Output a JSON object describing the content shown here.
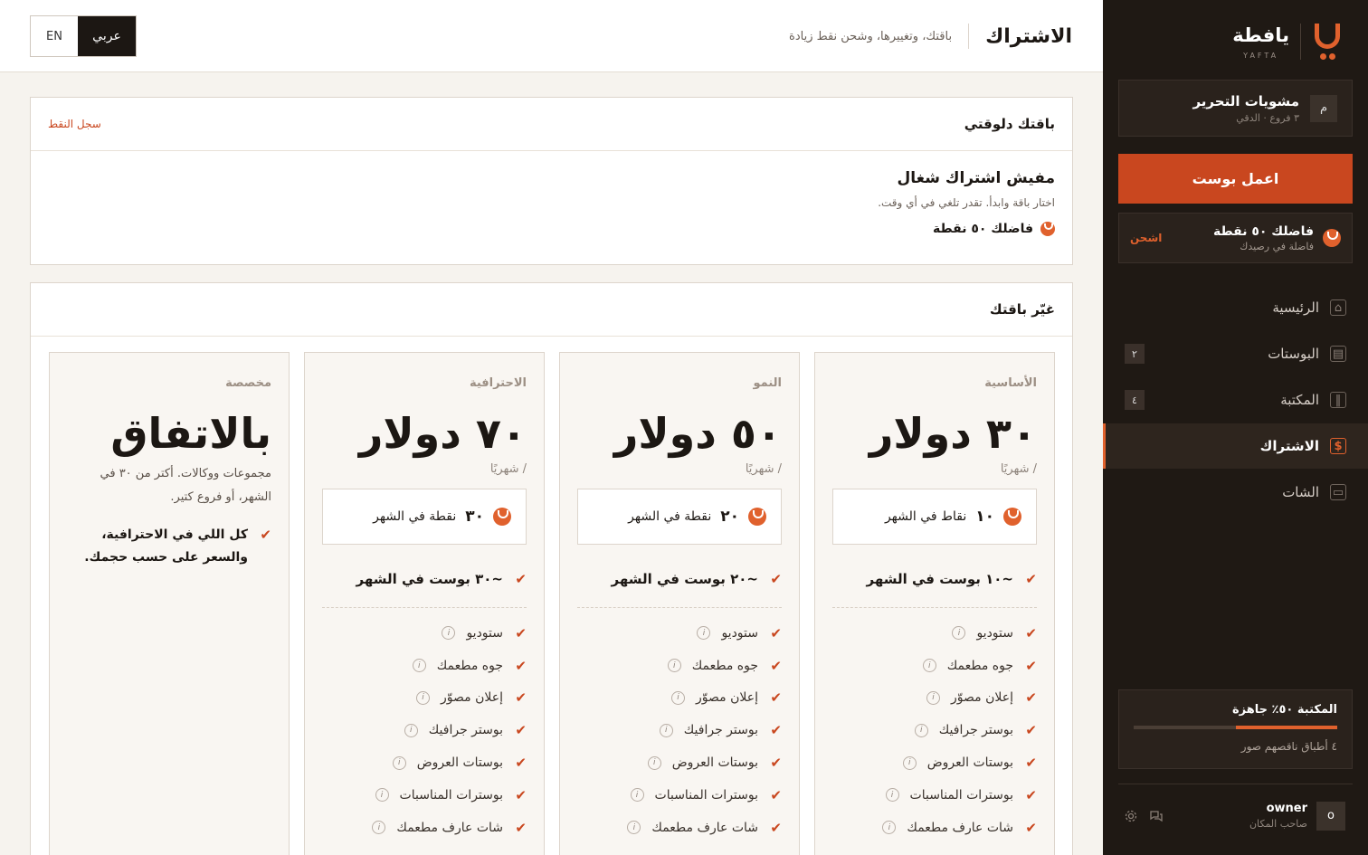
{
  "sidebar": {
    "brand_name": "يافطة",
    "brand_sub": "YAFTA",
    "restaurant": {
      "avatar": "م",
      "name": "مشويات التحرير",
      "sub": "٣ فروع · الدقي"
    },
    "cta_label": "اعمل بوست",
    "points": {
      "title": "فاضلك ٥٠ نقطة",
      "sub": "فاضلة في رصيدك",
      "link": "اشحن"
    },
    "nav": [
      {
        "label": "الرئيسية",
        "icon": "home-icon",
        "glyph": "⌂",
        "badge": ""
      },
      {
        "label": "البوستات",
        "icon": "posts-icon",
        "glyph": "▤",
        "badge": "٢"
      },
      {
        "label": "المكتبة",
        "icon": "library-icon",
        "glyph": "‖",
        "badge": "٤"
      },
      {
        "label": "الاشتراك",
        "icon": "subscription-icon",
        "glyph": "$",
        "badge": "",
        "active": true
      },
      {
        "label": "الشات",
        "icon": "chat-icon",
        "glyph": "▭",
        "badge": ""
      }
    ],
    "library": {
      "title": "المكتبة ٥٠٪ جاهزة",
      "progress_percent": 50,
      "sub": "٤ أطباق ناقصهم صور"
    },
    "user": {
      "avatar": "o",
      "name": "owner",
      "role": "صاحب المكان"
    }
  },
  "topbar": {
    "title": "الاشتراك",
    "subtitle": "باقتك، وتغييرها، وشحن نقط زيادة",
    "lang_en": "EN",
    "lang_ar": "عربي"
  },
  "current": {
    "heading": "باقتك دلوقتي",
    "link": "سجل النقط",
    "title": "مفيش اشتراك شغال",
    "sub": "اختار باقة وابدأ. تقدر تلغي في أي وقت.",
    "points": "فاضلك ٥٠ نقطة"
  },
  "change": {
    "heading": "غيّر باقتك",
    "plans": [
      {
        "name": "الأساسية",
        "price": "٣٠ دولار",
        "per": "/ شهريًا",
        "pts_num": "١٠",
        "pts_label": "نقاط في الشهر",
        "posts": "~١٠ بوست في الشهر"
      },
      {
        "name": "النمو",
        "price": "٥٠ دولار",
        "per": "/ شهريًا",
        "pts_num": "٢٠",
        "pts_label": "نقطة في الشهر",
        "posts": "~٢٠ بوست في الشهر"
      },
      {
        "name": "الاحترافية",
        "price": "٧٠ دولار",
        "per": "/ شهريًا",
        "pts_num": "٣٠",
        "pts_label": "نقطة في الشهر",
        "posts": "~٣٠ بوست في الشهر"
      }
    ],
    "features": [
      "ستوديو",
      "جوه مطعمك",
      "إعلان مصوّر",
      "بوستر جرافيك",
      "بوستات العروض",
      "بوسترات المناسبات",
      "شات عارف مطعمك"
    ],
    "custom": {
      "name": "مخصصة",
      "price": "بالاتفاق",
      "desc": "مجموعات ووكالات. أكتر من ٣٠ في الشهر، أو فروع كتير.",
      "feat_line1": "كل اللي في الاحترافية،",
      "feat_line2": "والسعر على حسب حجمك."
    }
  },
  "colors": {
    "accent": "#c9471f",
    "sidebar_bg": "#1f1914",
    "page_bg": "#f6f3ee"
  }
}
